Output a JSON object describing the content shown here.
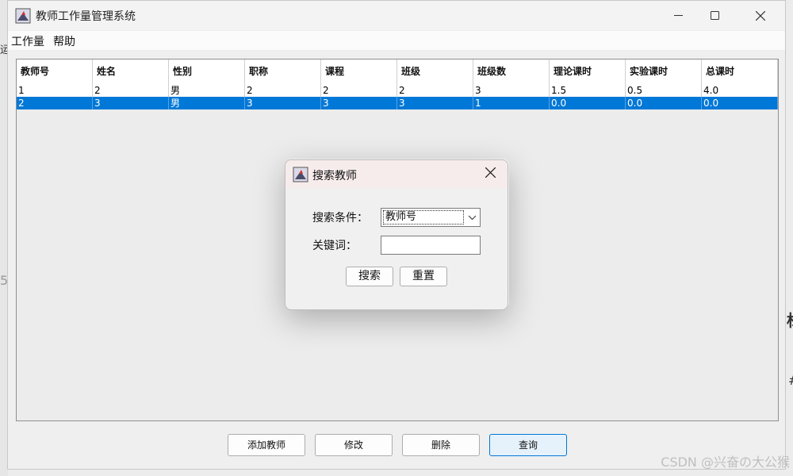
{
  "window": {
    "title": "教师工作量管理系统"
  },
  "menu": {
    "items": [
      "工作量",
      "帮助"
    ]
  },
  "table": {
    "headers": [
      "教师号",
      "姓名",
      "性别",
      "职称",
      "课程",
      "班级",
      "班级数",
      "理论课时",
      "实验课时",
      "总课时"
    ],
    "rows": [
      [
        "1",
        "2",
        "男",
        "2",
        "2",
        "2",
        "3",
        "1.5",
        "0.5",
        "4.0"
      ],
      [
        "2",
        "3",
        "男",
        "3",
        "3",
        "3",
        "1",
        "0.0",
        "0.0",
        "0.0"
      ]
    ],
    "selected_row": 1
  },
  "buttons": {
    "add": "添加教师",
    "edit": "修改",
    "delete": "删除",
    "query": "查询"
  },
  "dialog": {
    "title": "搜索教师",
    "condition_label": "搜索条件：",
    "condition_value": "教师号",
    "keyword_label": "关键词：",
    "keyword_value": "",
    "search_button": "搜索",
    "reset_button": "重置"
  },
  "background": {
    "chars": [
      "运",
      "5",
      "标",
      "#"
    ]
  },
  "watermark": "CSDN @兴奋の大公猴",
  "colors": {
    "selection": "#0078d7",
    "focus_border": "#0078d7"
  }
}
